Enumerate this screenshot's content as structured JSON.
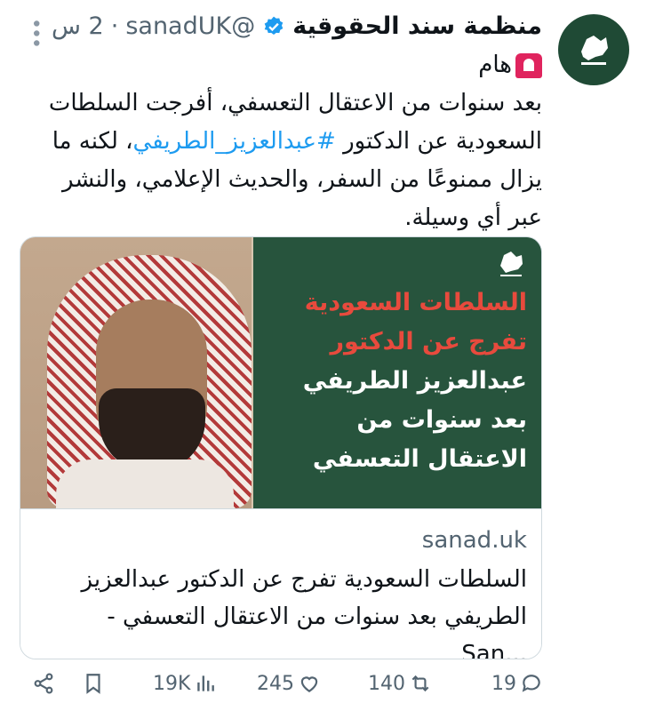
{
  "author": {
    "name": "منظمة سند الحقوقية",
    "handle": "@sanadUK",
    "separator": "·",
    "time": "2 س"
  },
  "tweet": {
    "label": "هام",
    "text_before": "بعد سنوات من الاعتقال التعسفي، أفرجت السلطات السعودية عن الدكتور ",
    "hashtag": "#عبدالعزيز_الطريفي",
    "text_after": "، لكنه ما يزال ممنوعًا من السفر، والحديث الإعلامي، والنشر عبر أي وسيلة."
  },
  "card": {
    "overlay_line1": "السلطات السعودية",
    "overlay_line2": "تفرج عن الدكتور",
    "overlay_line3": "عبدالعزيز الطريفي",
    "overlay_line4": "بعد سنوات من",
    "overlay_line5": "الاعتقال التعسفي",
    "domain": "sanad.uk",
    "title_line1": "السلطات السعودية تفرج عن الدكتور عبدالعزيز",
    "title_line2": "الطريفي بعد سنوات من الاعتقال التعسفي - ...San"
  },
  "actions": {
    "views": "19K",
    "likes": "245",
    "retweets": "140",
    "replies": "19"
  },
  "icons": [
    "more-icon",
    "verified-icon",
    "siren-icon",
    "share-icon",
    "bookmark-icon",
    "views-icon",
    "like-icon",
    "retweet-icon",
    "reply-icon"
  ],
  "colors": {
    "link": "#1d9bf0",
    "verified": "#1d9bf0",
    "panel_green": "#27543d",
    "overlay_red": "#e84a3d"
  }
}
